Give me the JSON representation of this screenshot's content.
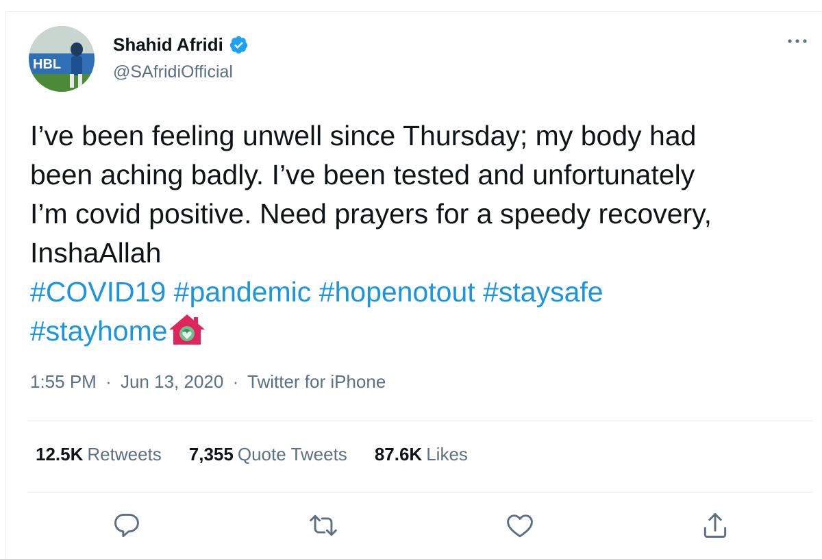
{
  "author": {
    "name": "Shahid Afridi",
    "handle": "@SAfridiOfficial",
    "verified": true,
    "avatar_text": "HBL"
  },
  "tweet": {
    "lines": [
      "I’ve been feeling unwell since Thursday; my body had",
      "been aching badly. I’ve been tested and unfortunately",
      "I’m covid positive. Need prayers for a speedy recovery,",
      "InshaAllah"
    ],
    "hashtags_line1": [
      "#COVID19",
      "#pandemic",
      "#hopenotout",
      "#staysafe"
    ],
    "hashtags_line2": [
      "#stayhome"
    ],
    "emoji": "house-with-heart-emoji"
  },
  "meta": {
    "time": "1:55 PM",
    "date": "Jun 13, 2020",
    "source": "Twitter for iPhone",
    "separator": "·"
  },
  "stats": {
    "retweets": {
      "count": "12.5K",
      "label": "Retweets"
    },
    "quotes": {
      "count": "7,355",
      "label": "Quote Tweets"
    },
    "likes": {
      "count": "87.6K",
      "label": "Likes"
    }
  },
  "actions": [
    "reply-icon",
    "retweet-icon",
    "like-icon",
    "share-icon"
  ],
  "colors": {
    "link": "#1b95e0",
    "secondary_text": "#5b7083",
    "divider": "#e6ecf0",
    "verified_badge": "#1da1f2",
    "emoji_house": "#e0245e"
  }
}
